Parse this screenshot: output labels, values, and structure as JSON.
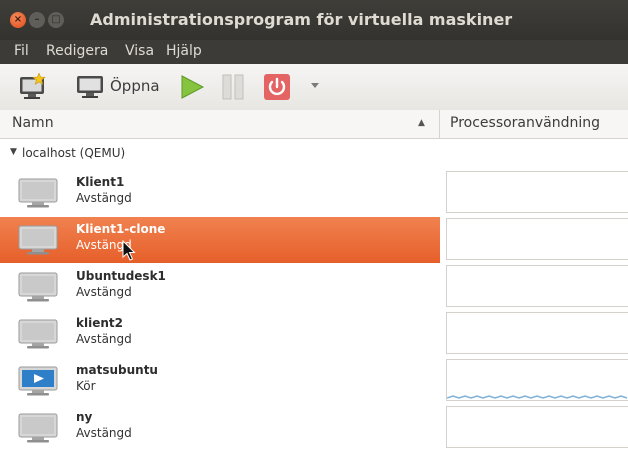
{
  "window": {
    "title": "Administrationsprogram för virtuella maskiner",
    "controls": {
      "close": "×",
      "minimize": "–",
      "maximize": "□"
    }
  },
  "menu": [
    "Fil",
    "Redigera",
    "Visa",
    "Hjälp"
  ],
  "toolbar": {
    "open_label": "Öppna",
    "new_icon": "new-vm-icon",
    "open_icon": "monitor-icon",
    "run_icon": "play-icon",
    "pause_icon": "pause-icon",
    "shutdown_icon": "power-icon",
    "dropdown_icon": "chevron-down-icon"
  },
  "table": {
    "columns": {
      "name": "Namn",
      "cpu": "Processoranvändning"
    },
    "sort_indicator": "▲",
    "group_label": "localhost (QEMU)",
    "group_toggle": "▼",
    "rows": [
      {
        "name": "Klient1",
        "status": "Avstängd",
        "running": false,
        "selected": false
      },
      {
        "name": "Klient1-clone",
        "status": "Avstängd",
        "running": false,
        "selected": true
      },
      {
        "name": "Ubuntudesk1",
        "status": "Avstängd",
        "running": false,
        "selected": false
      },
      {
        "name": "klient2",
        "status": "Avstängd",
        "running": false,
        "selected": false
      },
      {
        "name": "matsubuntu",
        "status": "Kör",
        "running": true,
        "selected": false
      },
      {
        "name": "ny",
        "status": "Avstängd",
        "running": false,
        "selected": false
      }
    ]
  },
  "colors": {
    "selection": "#e8672f",
    "titlebar": "#3c3b37",
    "close_button": "#e25b26",
    "run_green": "#7bbf3a",
    "power_red": "#e05050",
    "cpu_graph": "#7fb2d8"
  }
}
